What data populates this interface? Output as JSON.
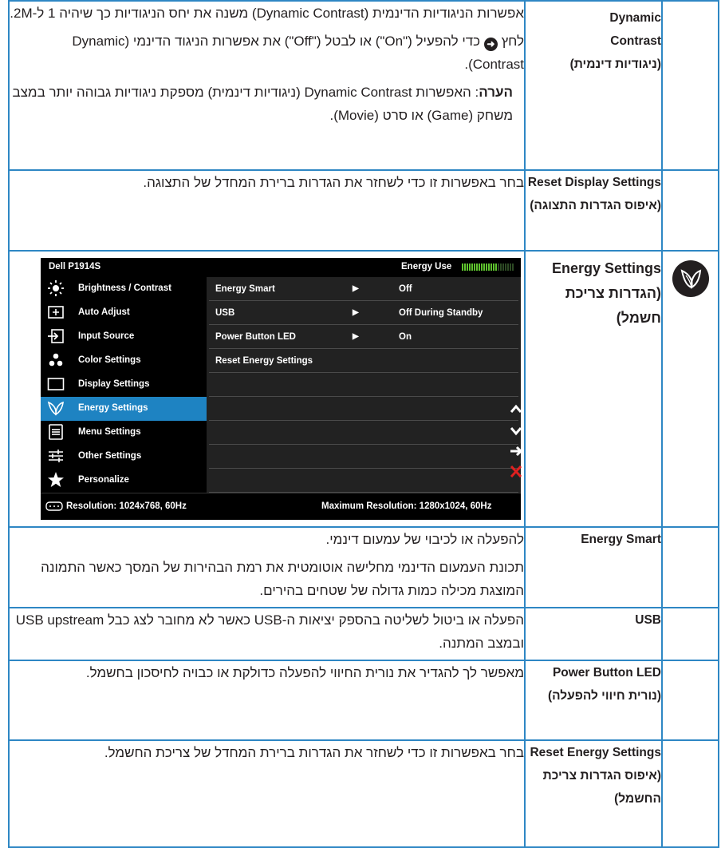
{
  "rows": {
    "dynamic_contrast": {
      "name_en": "Dynamic Contrast",
      "name_he": "(ניגודיות דינמית)",
      "p1": "אפשרות הניגודיות הדינמית (Dynamic Contrast) משנה את יחס הניגודיות כך שיהיה 1 ל-2M.",
      "p2_pre": "לחץ",
      "p2_post": "כדי להפעיל (\"On\") או לבטל (\"Off\") את אפשרות הניגוד הדינמי (Dynamic Contrast).",
      "note_label": "הערה",
      "note_text": ": האפשרות Dynamic Contrast (ניגודיות דינמית) מספקת ניגודיות גבוהה יותר במצב משחק (Game) או סרט (Movie)."
    },
    "reset_display": {
      "name_en": "Reset Display Settings",
      "name_he": "(איפוס הגדרות התצוגה)",
      "text": "בחר באפשרות זו כדי לשחזר את הגדרות ברירת המחדל של התצוגה."
    },
    "energy_settings": {
      "name_en": "Energy Settings",
      "name_he": "(הגדרות צריכת חשמל)"
    },
    "energy_smart": {
      "name": "Energy Smart",
      "p1": "להפעלה או לכיבוי של עמעום דינמי.",
      "p2": "תכונת העמעום הדינמי מחלישה אוטומטית את רמת הבהירות של המסך כאשר התמונה המוצגת מכילה כמות גדולה של שטחים בהירים."
    },
    "usb": {
      "name": "USB",
      "text": "הפעלה או ביטול לשליטה בהספק יציאות ה-USB כאשר לא מחובר לצג כבל USB upstream ובמצב המתנה."
    },
    "power_led": {
      "name_en": "Power Button LED",
      "name_he": "(נורית חיווי להפעלה)",
      "text": "מאפשר לך להגדיר את נורית החיווי להפעלה כדולקת או כבויה לחיסכון בחשמל."
    },
    "reset_energy": {
      "name_en": "Reset Energy Settings",
      "name_he": "(איפוס הגדרות צריכת החשמל)",
      "text": "בחר באפשרות זו כדי לשחזר את הגדרות ברירת המחדל של צריכת החשמל."
    }
  },
  "osd": {
    "model": "Dell P1914S",
    "energy_use_label": "Energy Use",
    "energy_level_fraction": 0.7,
    "menu": [
      {
        "label": "Brightness / Contrast",
        "icon": "brightness-icon"
      },
      {
        "label": "Auto Adjust",
        "icon": "auto-adjust-icon"
      },
      {
        "label": "Input Source",
        "icon": "input-source-icon"
      },
      {
        "label": "Color Settings",
        "icon": "color-settings-icon"
      },
      {
        "label": "Display Settings",
        "icon": "display-settings-icon"
      },
      {
        "label": "Energy Settings",
        "icon": "leaf-icon",
        "selected": true
      },
      {
        "label": "Menu Settings",
        "icon": "menu-settings-icon"
      },
      {
        "label": "Other Settings",
        "icon": "other-settings-icon"
      },
      {
        "label": "Personalize",
        "icon": "star-icon"
      }
    ],
    "options": [
      {
        "label": "Energy Smart",
        "value": "Off"
      },
      {
        "label": "USB",
        "value": "Off During Standby"
      },
      {
        "label": "Power Button LED",
        "value": "On"
      },
      {
        "label": "Reset Energy Settings",
        "value": ""
      }
    ],
    "resolution": "Resolution: 1024x768,  60Hz",
    "max_resolution": "Maximum Resolution: 1280x1024,  60Hz",
    "nav_icons": [
      "up-arrow-icon",
      "down-arrow-icon",
      "right-arrow-icon",
      "exit-x-icon"
    ],
    "colors": {
      "selected": "#1e83c2",
      "energy_green": "#5fc42e",
      "exit_red": "#e02020",
      "border": "#2e87c4"
    }
  }
}
